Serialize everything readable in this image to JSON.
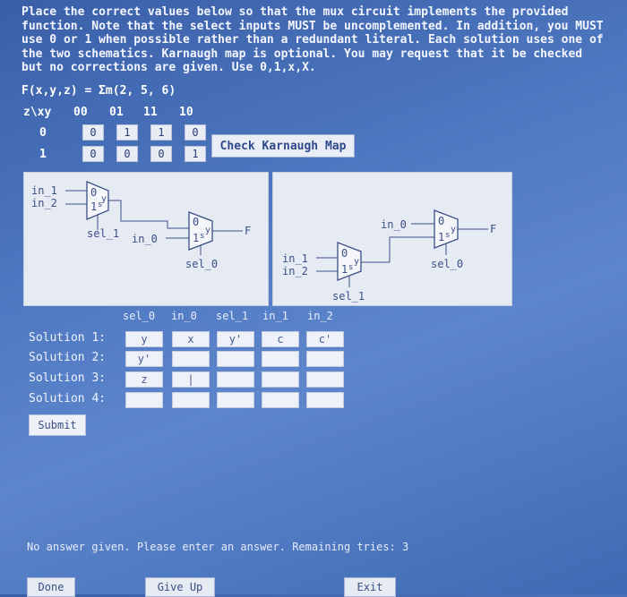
{
  "instructions": "Place the correct values below so that the mux circuit implements the provided function. Note that the select inputs MUST be uncomplemented. In addition, you MUST use 0 or 1 when possible rather than a redundant literal. Each solution uses one of the two schematics. Karnaugh map is optional. You may request that it be checked but no corrections are given. Use 0,1,x,X.",
  "function_label": "F(x,y,z) = Σm(2, 5, 6)",
  "kmap": {
    "corner": "z\\xy",
    "col_headers": [
      "00",
      "01",
      "11",
      "10"
    ],
    "rows": [
      {
        "label": "0",
        "cells": [
          "0",
          "1",
          "1",
          "0"
        ]
      },
      {
        "label": "1",
        "cells": [
          "0",
          "0",
          "0",
          "1"
        ]
      }
    ],
    "check_button": "Check Karnaugh Map"
  },
  "schematic1": {
    "in_1": "in_1",
    "in_2": "in_2",
    "sel_1": "sel_1",
    "in_0": "in_0",
    "sel_0": "sel_0",
    "F": "F",
    "zero": "0",
    "one": "1",
    "s": "s",
    "y": "y"
  },
  "schematic2": {
    "in_1": "in_1",
    "in_2": "in_2",
    "sel_1": "sel_1",
    "in_0": "in_0",
    "sel_0": "sel_0",
    "F": "F",
    "zero": "0",
    "one": "1",
    "s": "s",
    "y": "y"
  },
  "solution_headers": [
    "sel_0",
    "in_0",
    "sel_1",
    "in_1",
    "in_2"
  ],
  "solutions": [
    {
      "label": "Solution 1:",
      "values": [
        "y",
        "x",
        "y'",
        "c",
        "c'"
      ]
    },
    {
      "label": "Solution 2:",
      "values": [
        "y'",
        "",
        "",
        "",
        ""
      ]
    },
    {
      "label": "Solution 3:",
      "values": [
        "z",
        "|",
        "",
        "",
        ""
      ]
    },
    {
      "label": "Solution 4:",
      "values": [
        "",
        "",
        "",
        "",
        ""
      ]
    }
  ],
  "submit_label": "Submit",
  "status_message": "No answer given. Please enter an answer. Remaining tries: 3",
  "buttons": {
    "done": "Done",
    "give_up": "Give Up",
    "exit": "Exit"
  }
}
